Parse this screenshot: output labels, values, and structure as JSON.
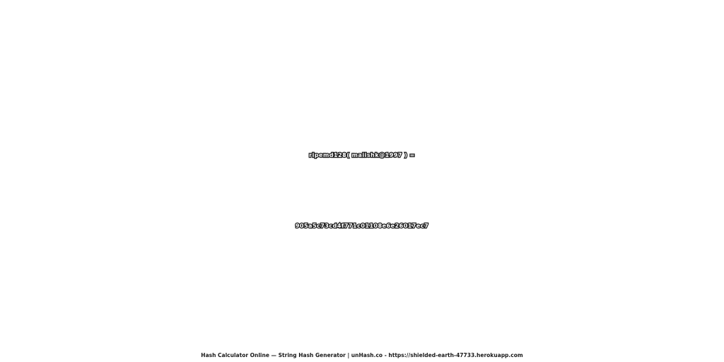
{
  "expression": "ripemd128( maiishk@1997 ) =",
  "hash": "905a5c73cd4f771c01108e6e26017ec7",
  "footer": "Hash Calculator Online — String Hash Generator | unHash.co - https://shielded-earth-47733.herokuapp.com",
  "colors": {
    "background": "#ffffff",
    "text_fill": "#ffffff",
    "text_outline": "#1a1a1a"
  }
}
